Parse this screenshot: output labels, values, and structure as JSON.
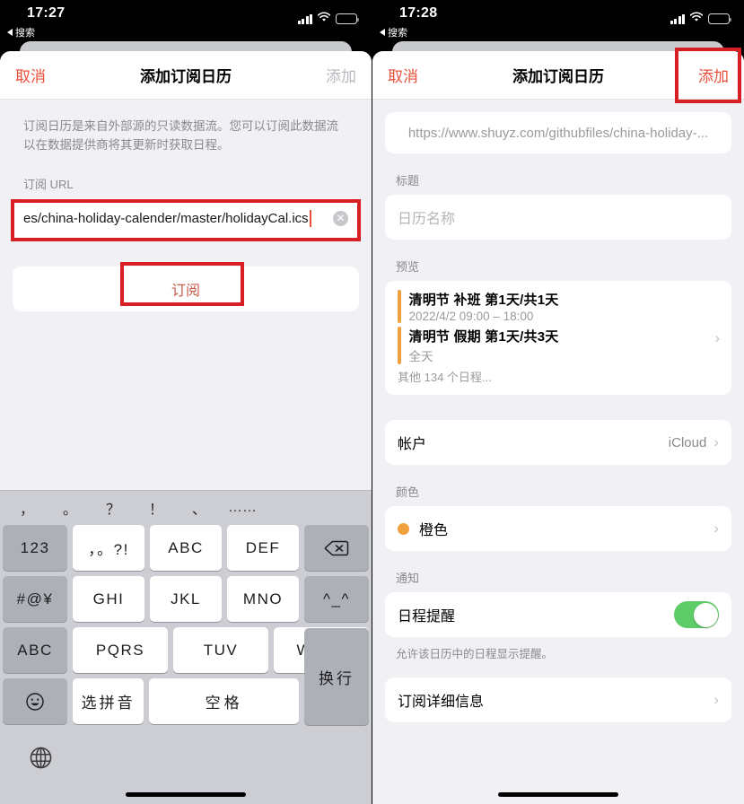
{
  "left": {
    "statusbar": {
      "time": "17:27",
      "back_label": "搜索",
      "signal_icon": "cellular-signal-icon",
      "wifi_icon": "wifi-icon",
      "battery_icon": "battery-icon"
    },
    "navbar": {
      "cancel": "取消",
      "title": "添加订阅日历",
      "add": "添加"
    },
    "description": "订阅日历是来自外部源的只读数据流。您可以订阅此数据流以在数据提供商将其更新时获取日程。",
    "url_field": {
      "label": "订阅 URL",
      "value": "es/china-holiday-calender/master/holidayCal.ics",
      "clear_icon": "clear-circle-icon"
    },
    "subscribe_button": "订阅",
    "keyboard": {
      "suggestions": [
        "，",
        "。",
        "？",
        "！",
        "、",
        "……"
      ],
      "rows": [
        [
          {
            "label": "123",
            "type": "fn"
          },
          {
            "label": "，。?!",
            "type": "key"
          },
          {
            "label": "ABC",
            "type": "key"
          },
          {
            "label": "DEF",
            "type": "key"
          },
          {
            "label": "backspace-icon",
            "type": "fn-icon"
          }
        ],
        [
          {
            "label": "#@¥",
            "type": "fn"
          },
          {
            "label": "GHI",
            "type": "key"
          },
          {
            "label": "JKL",
            "type": "key"
          },
          {
            "label": "MNO",
            "type": "key"
          },
          {
            "label": "^_^",
            "type": "fn"
          }
        ],
        [
          {
            "label": "ABC",
            "type": "fn"
          },
          {
            "label": "PQRS",
            "type": "key"
          },
          {
            "label": "TUV",
            "type": "key"
          },
          {
            "label": "WXYZ",
            "type": "key"
          },
          {
            "label": "换行",
            "type": "fn"
          }
        ],
        [
          {
            "label": "emoji-icon",
            "type": "fn-icon"
          },
          {
            "label": "选拼音",
            "type": "key"
          },
          {
            "label": "空格",
            "type": "key"
          }
        ]
      ],
      "globe_icon": "globe-icon"
    }
  },
  "right": {
    "statusbar": {
      "time": "17:28",
      "back_label": "搜索"
    },
    "navbar": {
      "cancel": "取消",
      "title": "添加订阅日历",
      "add": "添加"
    },
    "url_value": "https://www.shuyz.com/githubfiles/china-holiday-...",
    "title_field": {
      "label": "标题",
      "placeholder": "日历名称"
    },
    "preview": {
      "label": "预览",
      "events": [
        {
          "title": "清明节 补班 第1天/共1天",
          "time": "2022/4/2 09:00 – 18:00",
          "accent": "#f0a03c"
        },
        {
          "title": "清明节 假期 第1天/共3天",
          "time": "全天",
          "accent": "#f0a03c"
        }
      ],
      "more": "其他 134 个日程...",
      "chevron_icon": "chevron-right-icon"
    },
    "account": {
      "label": "帐户",
      "value": "iCloud",
      "chevron_icon": "chevron-right-icon"
    },
    "color": {
      "label": "颜色",
      "value": "橙色",
      "swatch": "#f0a03c",
      "chevron_icon": "chevron-right-icon"
    },
    "notification": {
      "label": "通知",
      "row_label": "日程提醒",
      "toggle_on": true,
      "toggle_color": "#5fcc6a",
      "footnote": "允许该日历中的日程显示提醒。"
    },
    "details": {
      "label": "订阅详细信息",
      "chevron_icon": "chevron-right-icon"
    }
  },
  "annotations": {
    "color": "#d81f26"
  }
}
